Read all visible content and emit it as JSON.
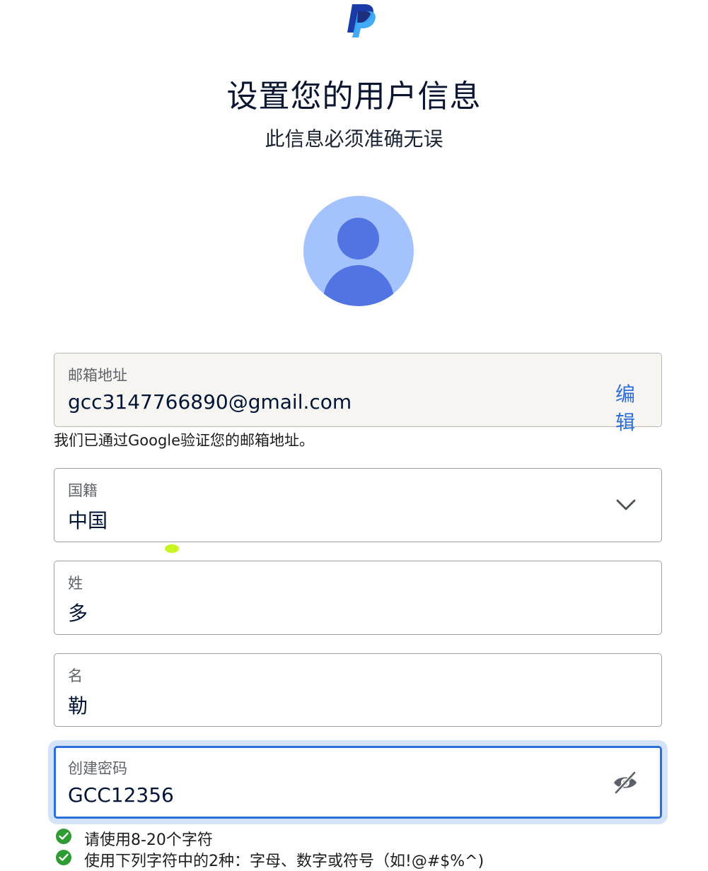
{
  "header": {
    "title": "设置您的用户信息",
    "subtitle": "此信息必须准确无误"
  },
  "avatar": {
    "icon": "avatar-placeholder-icon"
  },
  "email_field": {
    "label": "邮箱地址",
    "value": "gcc3147766890@gmail.com",
    "edit_label": "编辑",
    "helper": "我们已通过Google验证您的邮箱地址。"
  },
  "nationality_field": {
    "label": "国籍",
    "value": "中国"
  },
  "last_name_field": {
    "label": "姓",
    "value": "多"
  },
  "first_name_field": {
    "label": "名",
    "value": "勒"
  },
  "password_field": {
    "label": "创建密码",
    "value": "GCC12356"
  },
  "password_rules": [
    "请使用8-20个字符",
    "使用下列字符中的2种：字母、数字或符号（如!@#$%^)"
  ],
  "colors": {
    "accent": "#2d6fd8",
    "check": "#2f9b33",
    "avatar_bg": "#a4c2fd",
    "avatar_fg": "#5174e2"
  }
}
